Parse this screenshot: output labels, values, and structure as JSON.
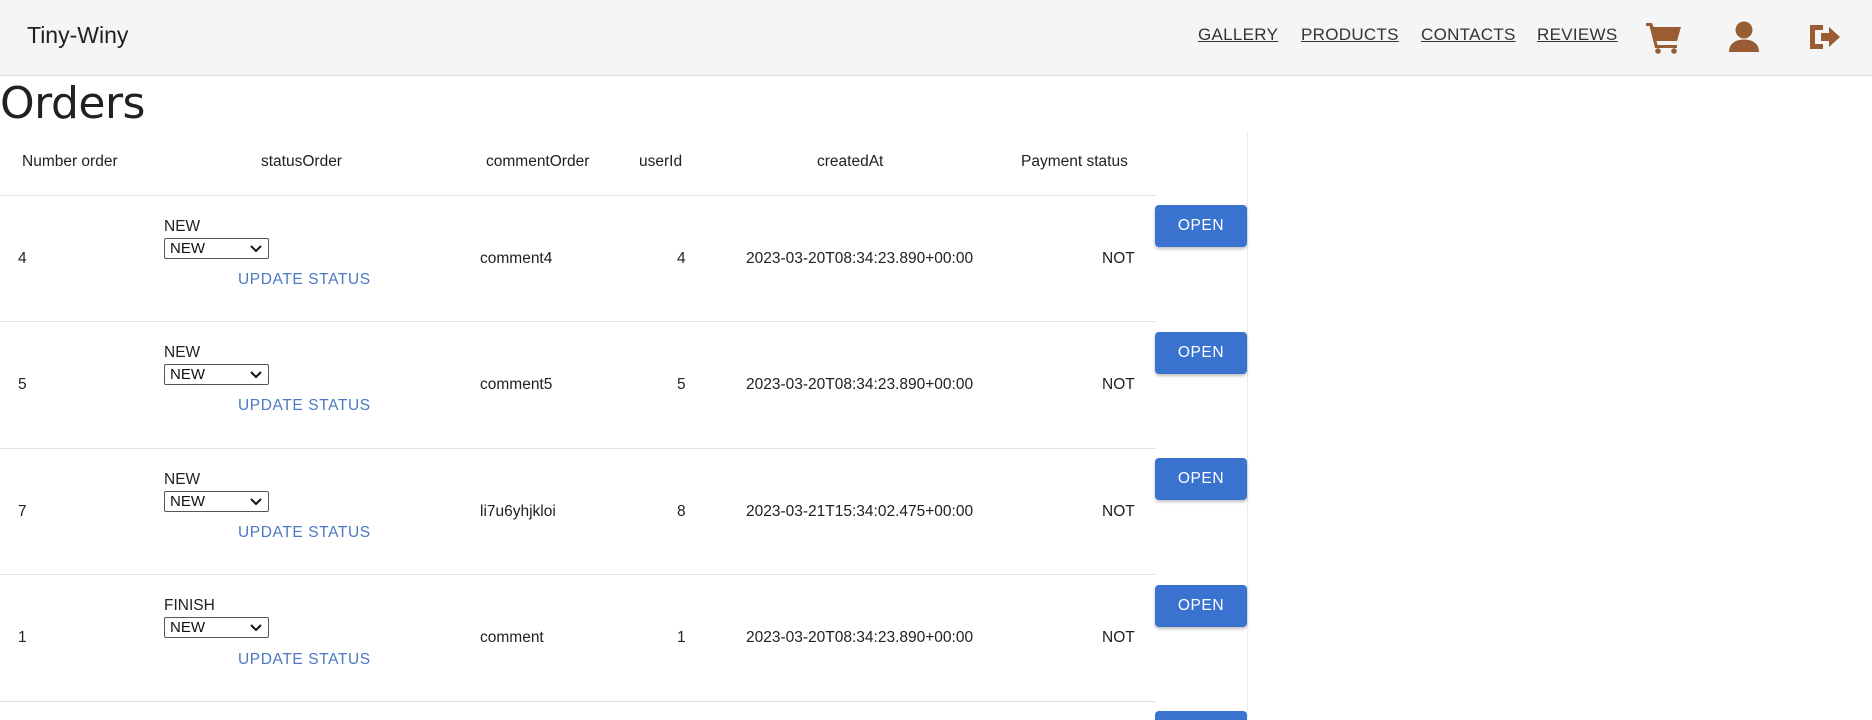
{
  "header": {
    "brand": "Tiny-Winy",
    "nav": [
      "GALLERY",
      "PRODUCTS",
      "CONTACTS",
      "REVIEWS"
    ],
    "icons": [
      "cart-icon",
      "user-icon",
      "logout-icon"
    ],
    "icon_color": "#9a5c33"
  },
  "page": {
    "title": "Orders"
  },
  "table": {
    "columns": [
      "Number order",
      "statusOrder",
      "commentOrder",
      "userId",
      "createdAt",
      "Payment status"
    ],
    "update_label": "UPDATE STATUS",
    "open_label": "OPEN",
    "rows": [
      {
        "number": "4",
        "status": "NEW",
        "select_value": "NEW",
        "comment": "comment4",
        "user_id": "4",
        "created_at": "2023-03-20T08:34:23.890+00:00",
        "payment": "NOT"
      },
      {
        "number": "5",
        "status": "NEW",
        "select_value": "NEW",
        "comment": "comment5",
        "user_id": "5",
        "created_at": "2023-03-20T08:34:23.890+00:00",
        "payment": "NOT"
      },
      {
        "number": "7",
        "status": "NEW",
        "select_value": "NEW",
        "comment": "li7u6yhjkloi",
        "user_id": "8",
        "created_at": "2023-03-21T15:34:02.475+00:00",
        "payment": "NOT"
      },
      {
        "number": "1",
        "status": "FINISH",
        "select_value": "NEW",
        "comment": "comment",
        "user_id": "1",
        "created_at": "2023-03-20T08:34:23.890+00:00",
        "payment": "NOT"
      }
    ]
  },
  "colors": {
    "accent": "#3a73cf",
    "link": "#4a78c2",
    "header_bg": "#f5f5f5"
  }
}
